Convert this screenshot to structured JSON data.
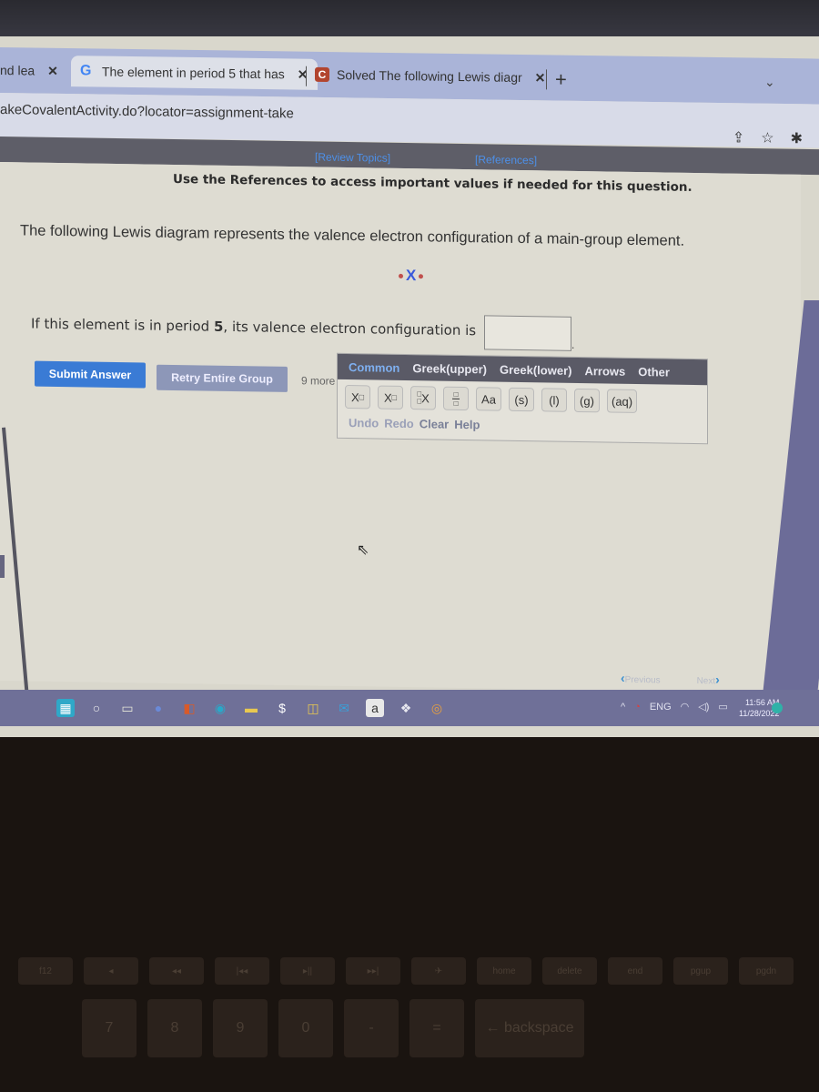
{
  "browser": {
    "tabs": [
      {
        "title": "nd lea",
        "favicon": "none",
        "active": false
      },
      {
        "title": "The element in period 5 that has",
        "favicon": "google-g-icon",
        "active": true
      },
      {
        "title": "Solved The following Lewis diagr",
        "favicon": "chegg-c-icon",
        "active": false
      }
    ],
    "tab_close_glyph": "✕",
    "new_tab_glyph": "+",
    "tab_menu_glyph": "⌄",
    "url": "akeCovalentActivity.do?locator=assignment-take",
    "toolbar_icons": [
      "share-icon",
      "star-icon",
      "extensions-icon"
    ],
    "toolbar_glyphs": [
      "⇪",
      "☆",
      "✱"
    ]
  },
  "topic_bar": {
    "review_topics": "[Review Topics]",
    "references": "[References]"
  },
  "content": {
    "references_note": "Use the References to access important values if needed for this question.",
    "question": "The following Lewis diagram represents the valence electron configuration of a main-group element.",
    "lewis_symbol": "X",
    "lewis_dot_count": 2,
    "prompt_before": "If this element is in period ",
    "prompt_period": "5",
    "prompt_after": ", its valence electron configuration is",
    "answer_value": "",
    "answer_period": "."
  },
  "buttons": {
    "submit": "Submit Answer",
    "retry": "Retry Entire Group",
    "more": "9 more"
  },
  "palette": {
    "tabs": [
      "Common",
      "Greek(upper)",
      "Greek(lower)",
      "Arrows",
      "Other"
    ],
    "active_tab": "Common",
    "keys": [
      "X□",
      "X□",
      "□X",
      "□/□",
      "Aa",
      "(s)",
      "(l)",
      "(g)",
      "(aq)"
    ],
    "key_names": [
      "superscript",
      "subscript",
      "pre-script",
      "fraction",
      "case",
      "solid",
      "liquid",
      "gas",
      "aqueous"
    ],
    "actions": [
      "Undo",
      "Redo",
      "Clear",
      "Help"
    ]
  },
  "pager": {
    "previous": "Previous",
    "next": "Next"
  },
  "taskbar": {
    "apps": [
      "windows-start-icon",
      "search-icon",
      "task-view-icon",
      "zoom-icon",
      "office-icon",
      "edge-icon",
      "file-explorer-icon",
      "app-icon",
      "store-icon",
      "mail-icon",
      "amazon-icon",
      "dropbox-icon",
      "chrome-icon"
    ],
    "app_glyphs": [
      "▦",
      "○",
      "▭",
      "●",
      "◧",
      "◉",
      "▬",
      "$",
      "◫",
      "✉",
      "a",
      "❖",
      "◎"
    ],
    "tray_lang": "ENG",
    "time": "11:56 AM",
    "date": "11/28/2022"
  },
  "keyboard": {
    "fn_row": [
      "f12",
      "◂",
      "◂◂",
      "|◂◂",
      "▸||",
      "▸▸|",
      "✈",
      "home",
      "delete",
      "end",
      "pgup",
      "pgdn"
    ],
    "num_row": [
      "7",
      "8",
      "9",
      "0",
      "-",
      "=",
      "← backspace"
    ]
  }
}
